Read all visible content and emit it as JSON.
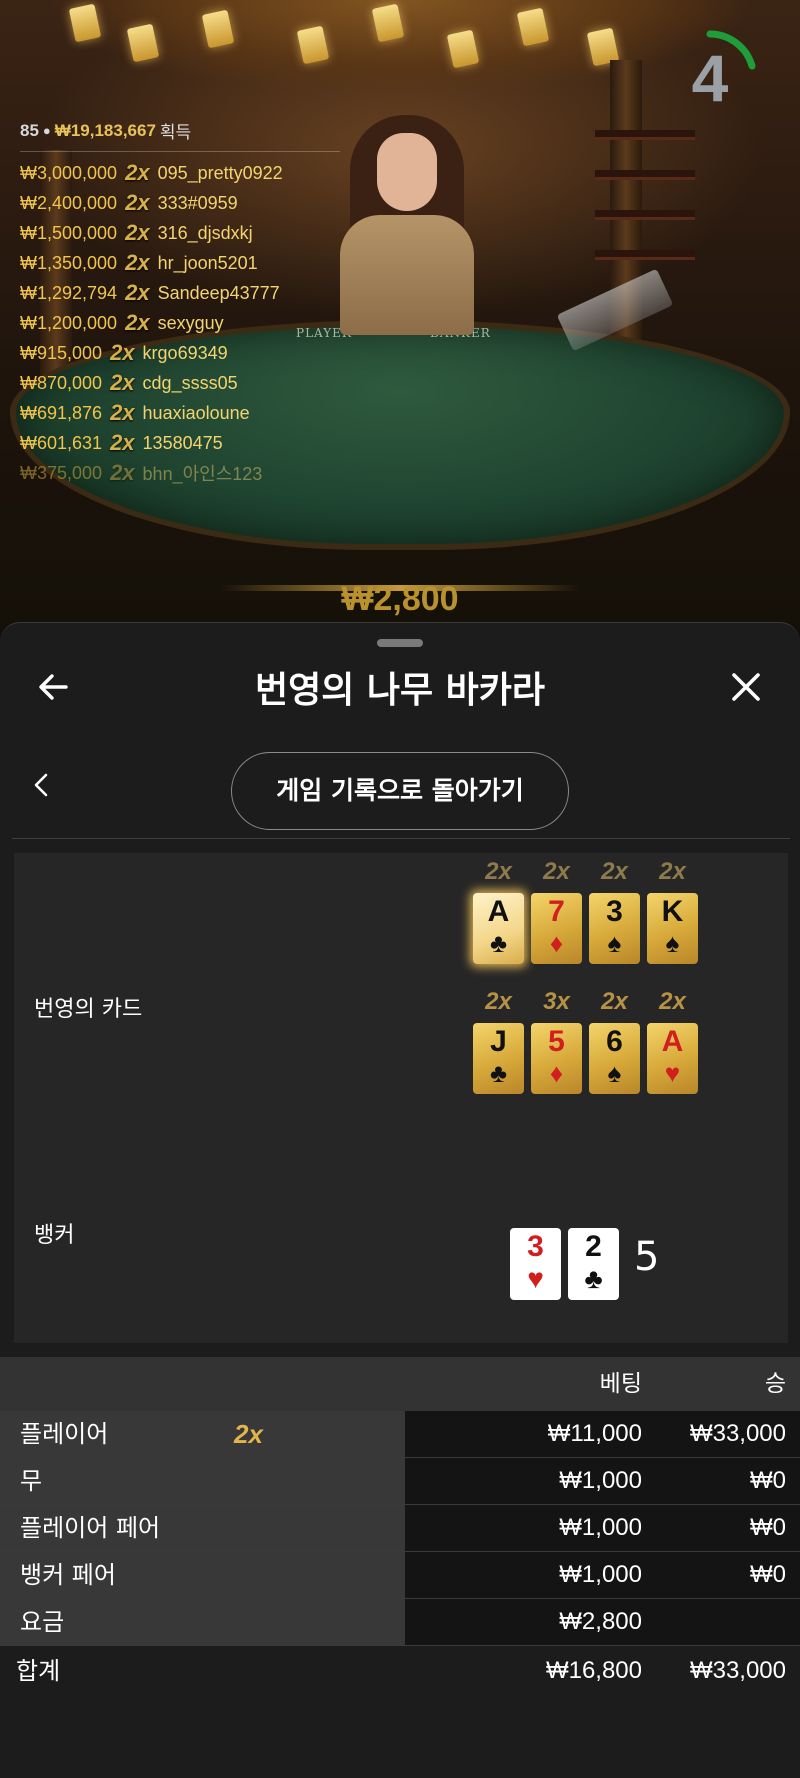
{
  "game": {
    "timer": "4",
    "table_labels": {
      "player": "PLAYER",
      "banker": "BANKER"
    },
    "bet_peek": "₩2,800"
  },
  "winners": {
    "count": "85",
    "total": "₩19,183,667",
    "suffix": "획득",
    "rows": [
      {
        "amount": "₩3,000,000",
        "mult": "2x",
        "user": "095_pretty0922"
      },
      {
        "amount": "₩2,400,000",
        "mult": "2x",
        "user": "333#0959"
      },
      {
        "amount": "₩1,500,000",
        "mult": "2x",
        "user": "316_djsdxkj"
      },
      {
        "amount": "₩1,350,000",
        "mult": "2x",
        "user": "hr_joon5201"
      },
      {
        "amount": "₩1,292,794",
        "mult": "2x",
        "user": "Sandeep43777"
      },
      {
        "amount": "₩1,200,000",
        "mult": "2x",
        "user": "sexyguy"
      },
      {
        "amount": "₩915,000",
        "mult": "2x",
        "user": "krgo69349"
      },
      {
        "amount": "₩870,000",
        "mult": "2x",
        "user": "cdg_ssss05"
      },
      {
        "amount": "₩691,876",
        "mult": "2x",
        "user": "huaxiaoloune"
      },
      {
        "amount": "₩601,631",
        "mult": "2x",
        "user": "13580475"
      },
      {
        "amount": "₩375,000",
        "mult": "2x",
        "user": "bhn_아인스123"
      }
    ]
  },
  "sheet": {
    "title": "번영의 나무 바카라",
    "history_button": "게임 기록으로 돌아가기",
    "prosperity_label": "번영의 카드",
    "banker_label": "뱅커",
    "prosperity_cards": [
      {
        "mult": "2x",
        "rank": "A",
        "suit": "♣",
        "color": "black",
        "selected": true
      },
      {
        "mult": "2x",
        "rank": "7",
        "suit": "♦",
        "color": "red"
      },
      {
        "mult": "2x",
        "rank": "3",
        "suit": "♠",
        "color": "black"
      },
      {
        "mult": "2x",
        "rank": "K",
        "suit": "♠",
        "color": "black"
      },
      {
        "mult": "2x",
        "rank": "J",
        "suit": "♣",
        "color": "black"
      },
      {
        "mult": "3x",
        "rank": "5",
        "suit": "♦",
        "color": "red"
      },
      {
        "mult": "2x",
        "rank": "6",
        "suit": "♠",
        "color": "black"
      },
      {
        "mult": "2x",
        "rank": "A",
        "suit": "♥",
        "color": "red"
      }
    ],
    "banker_cards": [
      {
        "rank": "3",
        "suit": "♥",
        "color": "red"
      },
      {
        "rank": "2",
        "suit": "♣",
        "color": "black"
      }
    ],
    "banker_score": "5"
  },
  "bets": {
    "headers": {
      "bet": "베팅",
      "win": "승"
    },
    "rows": [
      {
        "name": "플레이어",
        "mult": "2x",
        "bet": "₩11,000",
        "win": "₩33,000"
      },
      {
        "name": "무",
        "mult": "",
        "bet": "₩1,000",
        "win": "₩0"
      },
      {
        "name": "플레이어 페어",
        "mult": "",
        "bet": "₩1,000",
        "win": "₩0"
      },
      {
        "name": "뱅커 페어",
        "mult": "",
        "bet": "₩1,000",
        "win": "₩0"
      },
      {
        "name": "요금",
        "mult": "",
        "bet": "₩2,800",
        "win": ""
      }
    ],
    "total": {
      "name": "합계",
      "bet": "₩16,800",
      "win": "₩33,000"
    }
  },
  "colors": {
    "accent_gold": "#e2b54c",
    "timer_arc": "#1f9d3a",
    "sheet_bg": "#1c1c1c",
    "red_suit": "#d11f1f"
  },
  "icons": [
    "back-arrow-icon",
    "close-icon",
    "chevron-left-icon",
    "person-icon"
  ]
}
